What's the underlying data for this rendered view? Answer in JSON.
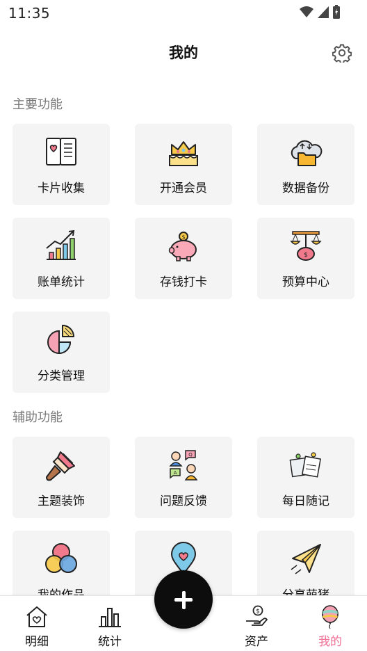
{
  "status_bar": {
    "time": "11:35"
  },
  "header": {
    "title": "我的"
  },
  "sections": {
    "main": {
      "title": "主要功能",
      "items": [
        {
          "label": "卡片收集",
          "icon": "card-collection-icon"
        },
        {
          "label": "开通会员",
          "icon": "crown-cake-icon"
        },
        {
          "label": "数据备份",
          "icon": "cloud-folder-icon"
        },
        {
          "label": "账单统计",
          "icon": "bar-chart-icon"
        },
        {
          "label": "存钱打卡",
          "icon": "piggy-bank-icon"
        },
        {
          "label": "预算中心",
          "icon": "budget-scale-icon"
        },
        {
          "label": "分类管理",
          "icon": "pie-chart-icon"
        }
      ]
    },
    "aux": {
      "title": "辅助功能",
      "items": [
        {
          "label": "主题装饰",
          "icon": "paint-brush-icon"
        },
        {
          "label": "问题反馈",
          "icon": "feedback-people-icon"
        },
        {
          "label": "每日随记",
          "icon": "notes-icon"
        },
        {
          "label": "我的作品",
          "icon": "color-circles-icon"
        },
        {
          "label": "",
          "icon": "heart-pin-icon"
        },
        {
          "label": "分享萌猪",
          "icon": "paper-plane-icon"
        }
      ]
    }
  },
  "tabbar": {
    "items": [
      {
        "label": "明细",
        "icon": "house-heart-icon"
      },
      {
        "label": "统计",
        "icon": "bar-chart-outline-icon"
      },
      {
        "label": "资产",
        "icon": "hand-coin-icon"
      },
      {
        "label": "我的",
        "icon": "balloon-icon"
      }
    ],
    "active": "我的",
    "active_color": "#ef6f95"
  },
  "fab": {
    "icon": "plus-icon"
  }
}
